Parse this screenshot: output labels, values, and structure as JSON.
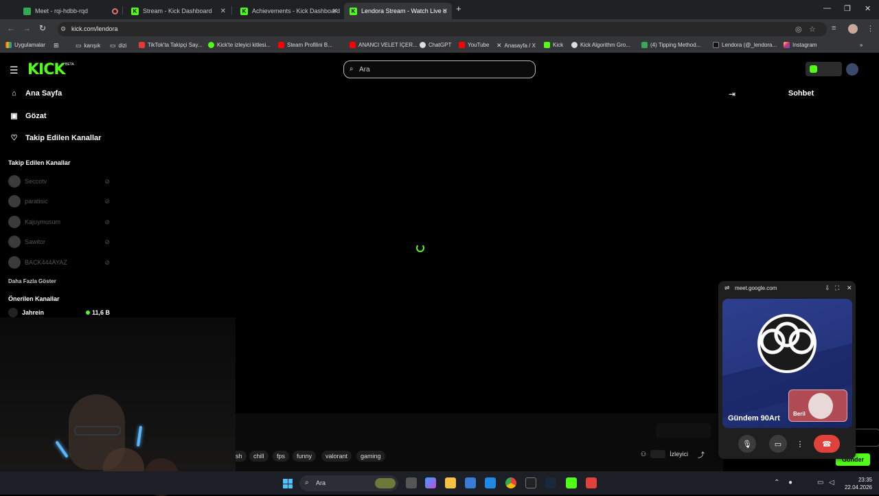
{
  "browser": {
    "tabs": [
      {
        "title": "Meet - rqi-hdbb-rqd"
      },
      {
        "title": "Stream - Kick Dashboard"
      },
      {
        "title": "Achievements - Kick Dashboard"
      },
      {
        "title": "Lendora Stream - Watch Live o"
      }
    ],
    "url": "kick.com/lendora",
    "bookmarks": [
      "Uygulamalar",
      "karışık",
      "dizi",
      "TikTok'ta Takipçi Say...",
      "Kick'te izleyici kitlesi...",
      "Steam Profilini B...",
      "ANANCI VELET İÇER...",
      "ChatGPT",
      "YouTube",
      "Anasayfa / X",
      "Kick",
      "Kick Algorithm Gro...",
      "(4) Tipping Method...",
      "Lendora (@_lendora...",
      "Instagram"
    ]
  },
  "header": {
    "logo": "KICK",
    "logo_badge": "BETA",
    "search_placeholder": "Ara"
  },
  "sidebar": {
    "nav": [
      {
        "label": "Ana Sayfa",
        "icon": "home-icon"
      },
      {
        "label": "Gözat",
        "icon": "browse-icon"
      },
      {
        "label": "Takip Edilen Kanallar",
        "icon": "heart-icon"
      }
    ],
    "followed_heading": "Takip Edilen Kanallar",
    "followed": [
      "Seccotv",
      "paratisic",
      "Kajuymusum",
      "Sawitor",
      "BACK444AYAZ"
    ],
    "more_label": "Daha Fazla Göster",
    "recommended_heading": "Önerilen Kanallar",
    "recommended": [
      {
        "name": "Jahrein",
        "viewers": "11,6 B"
      }
    ]
  },
  "stream": {
    "tags": [
      "sh",
      "chill",
      "fps",
      "funny",
      "valorant",
      "gaming"
    ],
    "viewers_label": "İzleyici"
  },
  "chat": {
    "title": "Sohbet",
    "send_label": "Gönder"
  },
  "meet_pip": {
    "url": "meet.google.com",
    "main_name": "Gündem 90Art",
    "participant": "Beril"
  },
  "taskbar": {
    "search_placeholder": "Ara",
    "time": "23:35",
    "date": "22.04.2026"
  },
  "colors": {
    "kick_green": "#53fc18",
    "end_call_red": "#e0413a"
  }
}
